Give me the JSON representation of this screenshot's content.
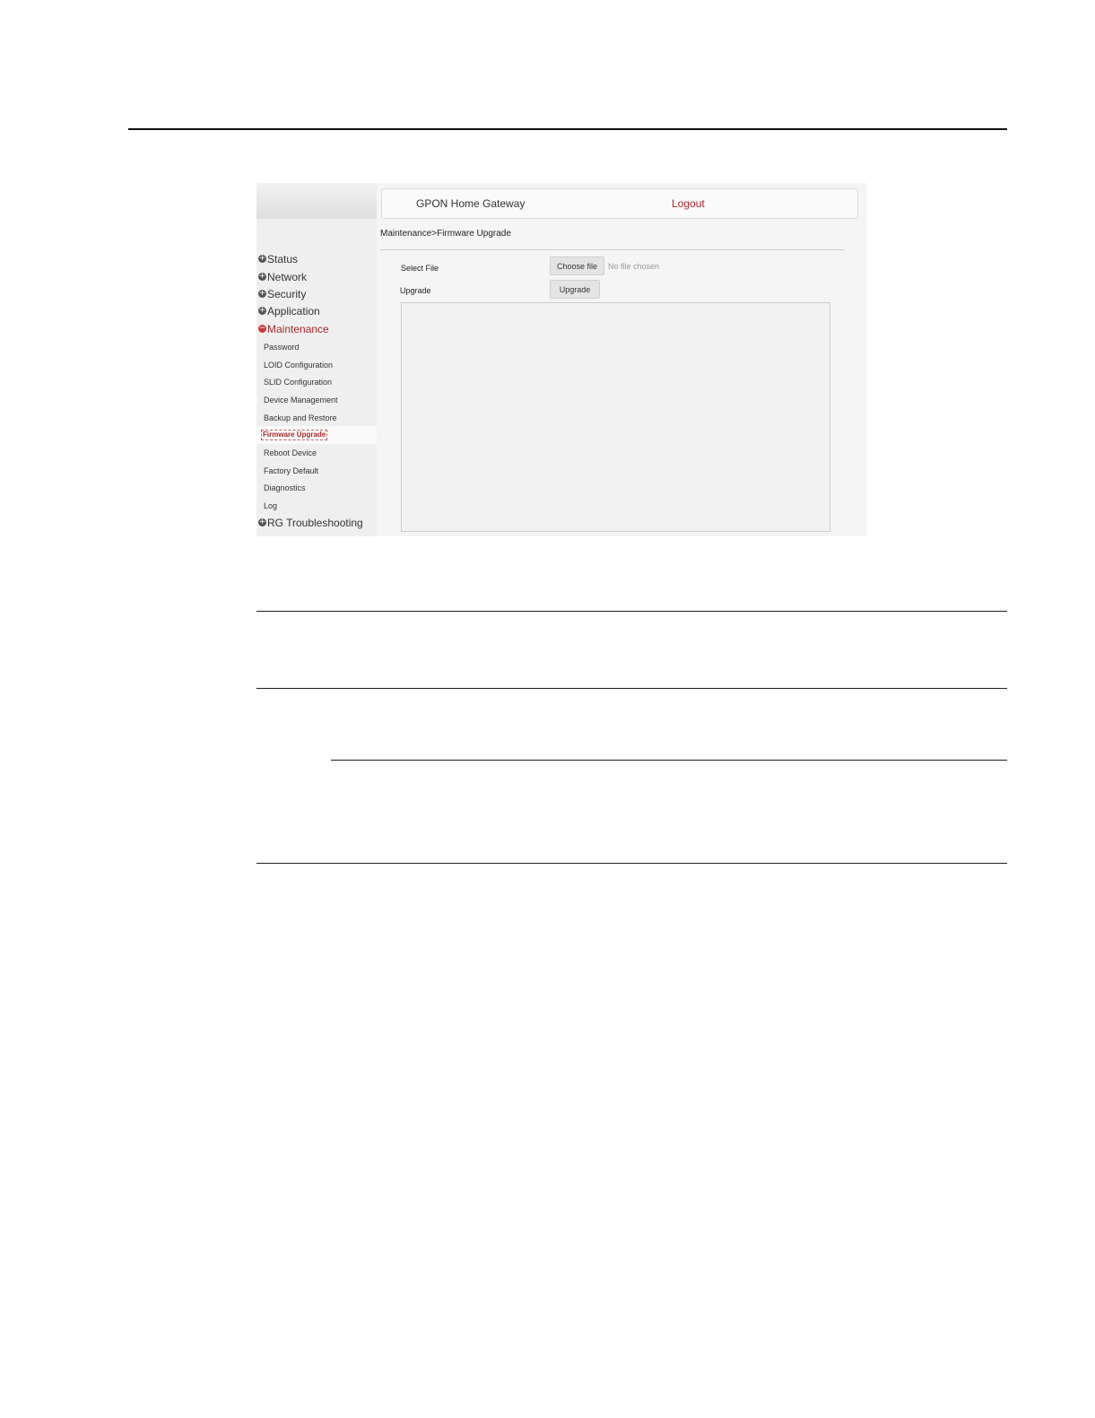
{
  "header": {
    "title": "GPON Home Gateway",
    "logout_label": "Logout"
  },
  "sidebar": {
    "items": [
      {
        "label": "Status"
      },
      {
        "label": "Network"
      },
      {
        "label": "Security"
      },
      {
        "label": "Application"
      },
      {
        "label": "Maintenance"
      },
      {
        "label": "RG Troubleshooting"
      }
    ],
    "maintenance_subitems": [
      {
        "label": "Password"
      },
      {
        "label": "LOID Configuration"
      },
      {
        "label": "SLID Configuration"
      },
      {
        "label": "Device Management"
      },
      {
        "label": "Backup and Restore"
      },
      {
        "label": "Firmware Upgrade"
      },
      {
        "label": "Reboot Device"
      },
      {
        "label": "Factory Default"
      },
      {
        "label": "Diagnostics"
      },
      {
        "label": "Log"
      }
    ]
  },
  "main": {
    "breadcrumb": "Maintenance>Firmware Upgrade",
    "select_file_label": "Select File",
    "choose_file_button": "Choose file",
    "file_status": "No file chosen",
    "upgrade_label": "Upgrade",
    "upgrade_button": "Upgrade"
  }
}
